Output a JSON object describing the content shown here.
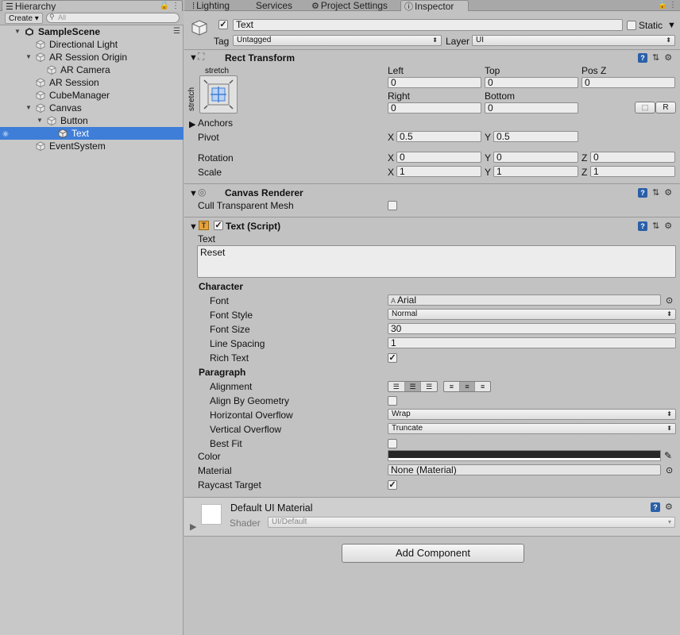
{
  "hierarchy": {
    "tab_label": "Hierarchy",
    "create_label": "Create",
    "search_placeholder": "All",
    "items": [
      {
        "label": "SampleScene",
        "bold": true
      },
      {
        "label": "Directional Light"
      },
      {
        "label": "AR Session Origin"
      },
      {
        "label": "AR Camera"
      },
      {
        "label": "AR Session"
      },
      {
        "label": "CubeManager"
      },
      {
        "label": "Canvas"
      },
      {
        "label": "Button"
      },
      {
        "label": "Text"
      },
      {
        "label": "EventSystem"
      }
    ]
  },
  "tabs": [
    {
      "label": "Lighting"
    },
    {
      "label": "Services"
    },
    {
      "label": "Project Settings"
    },
    {
      "label": "Inspector"
    }
  ],
  "object": {
    "name": "Text",
    "active": true,
    "static_label": "Static",
    "tag_label": "Tag",
    "tag_value": "Untagged",
    "layer_label": "Layer",
    "layer_value": "UI"
  },
  "rect_transform": {
    "title": "Rect Transform",
    "anchor_preset_label": "stretch",
    "anchor_preset_side": "stretch",
    "left_label": "Left",
    "left": "0",
    "top_label": "Top",
    "top": "0",
    "posz_label": "Pos Z",
    "posz": "0",
    "right_label": "Right",
    "right": "0",
    "bottom_label": "Bottom",
    "bottom": "0",
    "r_button": "R",
    "anchors_label": "Anchors",
    "pivot_label": "Pivot",
    "pivot_x": "0.5",
    "pivot_y": "0.5",
    "rotation_label": "Rotation",
    "rotation_x": "0",
    "rotation_y": "0",
    "rotation_z": "0",
    "scale_label": "Scale",
    "scale_x": "1",
    "scale_y": "1",
    "scale_z": "1",
    "x": "X",
    "y": "Y",
    "z": "Z"
  },
  "canvas_renderer": {
    "title": "Canvas Renderer",
    "cull_label": "Cull Transparent Mesh",
    "cull": false
  },
  "text_script": {
    "title": "Text (Script)",
    "text_label": "Text",
    "text_value": "Reset",
    "character_label": "Character",
    "font_label": "Font",
    "font_value": "Arial",
    "font_style_label": "Font Style",
    "font_style_value": "Normal",
    "font_size_label": "Font Size",
    "font_size_value": "30",
    "line_spacing_label": "Line Spacing",
    "line_spacing_value": "1",
    "rich_text_label": "Rich Text",
    "rich_text": true,
    "paragraph_label": "Paragraph",
    "alignment_label": "Alignment",
    "align_by_geometry_label": "Align By Geometry",
    "align_by_geometry": false,
    "h_overflow_label": "Horizontal Overflow",
    "h_overflow_value": "Wrap",
    "v_overflow_label": "Vertical Overflow",
    "v_overflow_value": "Truncate",
    "best_fit_label": "Best Fit",
    "best_fit": false,
    "color_label": "Color",
    "color_value": "#282828",
    "material_label": "Material",
    "material_value": "None (Material)",
    "raycast_label": "Raycast Target",
    "raycast": true
  },
  "material": {
    "name": "Default UI Material",
    "shader_label": "Shader",
    "shader_value": "UI/Default"
  },
  "add_component_label": "Add Component",
  "colors": {
    "selection": "#3e7ed8",
    "panel": "#c2c2c2"
  }
}
